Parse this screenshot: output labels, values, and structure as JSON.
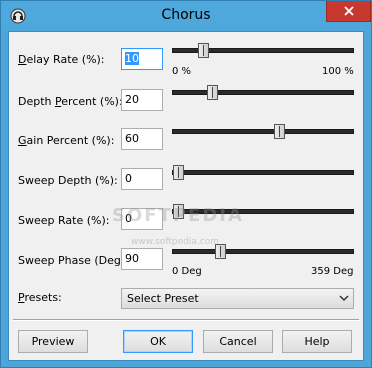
{
  "window": {
    "title": "Chorus",
    "close_icon": "close-x-icon"
  },
  "rows": [
    {
      "label": "Delay Rate (%):",
      "underline": "D",
      "rest": "elay Rate (%):",
      "value": "10",
      "fraction": 0.15
    },
    {
      "label": "Depth Percent (%):",
      "pre": "Depth ",
      "underline": "P",
      "rest": "ercent (%):",
      "value": "20",
      "fraction": 0.2
    },
    {
      "label": "Gain Percent (%):",
      "underline": "G",
      "rest": "ain Percent (%):",
      "value": "60",
      "fraction": 0.6
    },
    {
      "label": "Sweep Depth (%):",
      "value": "0",
      "fraction": 0.0
    },
    {
      "label": "Sweep Rate (%):",
      "value": "0",
      "fraction": 0.0
    },
    {
      "label": "Sweep Phase (Deg):",
      "value": "90",
      "fraction": 0.25
    }
  ],
  "scales": {
    "percent_min": "0 %",
    "percent_max": "100 %",
    "deg_min": "0 Deg",
    "deg_max": "359 Deg"
  },
  "presets": {
    "label": "Presets:",
    "underline": "P",
    "rest": "resets:",
    "selected": "Select Preset"
  },
  "buttons": {
    "preview": "Preview",
    "ok": "OK",
    "cancel": "Cancel",
    "help": "Help"
  },
  "watermark": {
    "main": "SOFTPEDIA",
    "sub": "www.softpedia.com"
  }
}
